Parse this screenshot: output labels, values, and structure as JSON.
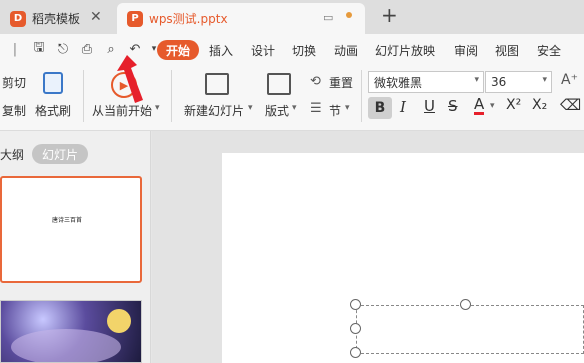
{
  "tabs": {
    "home_label": "稻壳模板",
    "doc_label": "wps测试.pptx",
    "new_tab_symbol": "+"
  },
  "menu": [
    "开始",
    "插入",
    "设计",
    "切换",
    "动画",
    "幻灯片放映",
    "审阅",
    "视图",
    "安全"
  ],
  "ribbon": {
    "cut": "剪切",
    "copy": "复制",
    "format_painter": "格式刷",
    "play_from_current": "从当前开始",
    "new_slide": "新建幻灯片",
    "layout": "版式",
    "reset": "重置",
    "section": "节",
    "font_name": "微软雅黑",
    "font_size": "36"
  },
  "left_panel": {
    "outline_tab": "大纲",
    "slides_tab": "幻灯片",
    "thumb1_title": "唐诗三百首"
  },
  "colors": {
    "accent": "#e65a2c",
    "arrow": "#e6202b"
  }
}
